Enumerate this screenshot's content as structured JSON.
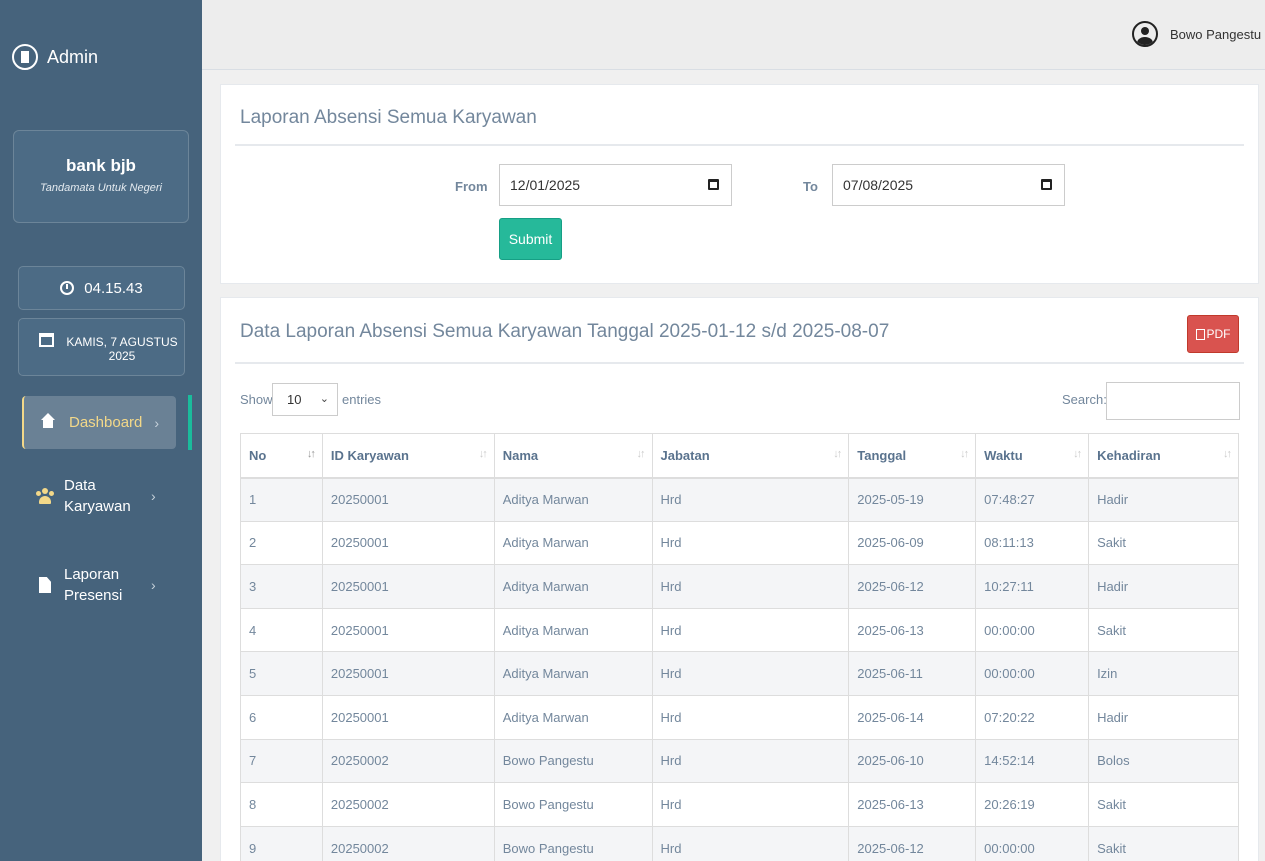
{
  "sidebar": {
    "brand": "Admin",
    "bank_name": "bank bjb",
    "tagline": "Tandamata Untuk Negeri",
    "clock": "04.15.43",
    "date": "KAMIS, 7 AGUSTUS 2025",
    "nav": [
      {
        "label": "Dashboard",
        "icon": "home-icon"
      },
      {
        "label": "Data Karyawan",
        "icon": "users-icon"
      },
      {
        "label": "Laporan Presensi",
        "icon": "file-icon"
      }
    ],
    "chevron": "›"
  },
  "topbar": {
    "user_name": "Bowo Pangestu"
  },
  "filter": {
    "title": "Laporan Absensi Semua Karyawan",
    "from_label": "From",
    "from_value": "12/01/2025",
    "to_label": "To",
    "to_value": "07/08/2025",
    "submit_label": "Submit"
  },
  "report": {
    "title": "Data Laporan Absensi Semua Karyawan Tanggal 2025-01-12 s/d 2025-08-07",
    "pdf_label": "PDF",
    "show_label": "Show",
    "show_value": "10",
    "entries_label": "entries",
    "search_label": "Search:"
  },
  "table": {
    "columns": [
      "No",
      "ID Karyawan",
      "Nama",
      "Jabatan",
      "Tanggal",
      "Waktu",
      "Kehadiran"
    ],
    "rows": [
      [
        "1",
        "20250001",
        "Aditya Marwan",
        "Hrd",
        "2025-05-19",
        "07:48:27",
        "Hadir"
      ],
      [
        "2",
        "20250001",
        "Aditya Marwan",
        "Hrd",
        "2025-06-09",
        "08:11:13",
        "Sakit"
      ],
      [
        "3",
        "20250001",
        "Aditya Marwan",
        "Hrd",
        "2025-06-12",
        "10:27:11",
        "Hadir"
      ],
      [
        "4",
        "20250001",
        "Aditya Marwan",
        "Hrd",
        "2025-06-13",
        "00:00:00",
        "Sakit"
      ],
      [
        "5",
        "20250001",
        "Aditya Marwan",
        "Hrd",
        "2025-06-11",
        "00:00:00",
        "Izin"
      ],
      [
        "6",
        "20250001",
        "Aditya Marwan",
        "Hrd",
        "2025-06-14",
        "07:20:22",
        "Hadir"
      ],
      [
        "7",
        "20250002",
        "Bowo Pangestu",
        "Hrd",
        "2025-06-10",
        "14:52:14",
        "Bolos"
      ],
      [
        "8",
        "20250002",
        "Bowo Pangestu",
        "Hrd",
        "2025-06-13",
        "20:26:19",
        "Sakit"
      ],
      [
        "9",
        "20250002",
        "Bowo Pangestu",
        "Hrd",
        "2025-06-12",
        "00:00:00",
        "Sakit"
      ]
    ]
  },
  "colors": {
    "sidebar": "#46637c",
    "accent": "#26b99a",
    "pdf": "#d9534f",
    "active_nav": "#f3d889"
  }
}
